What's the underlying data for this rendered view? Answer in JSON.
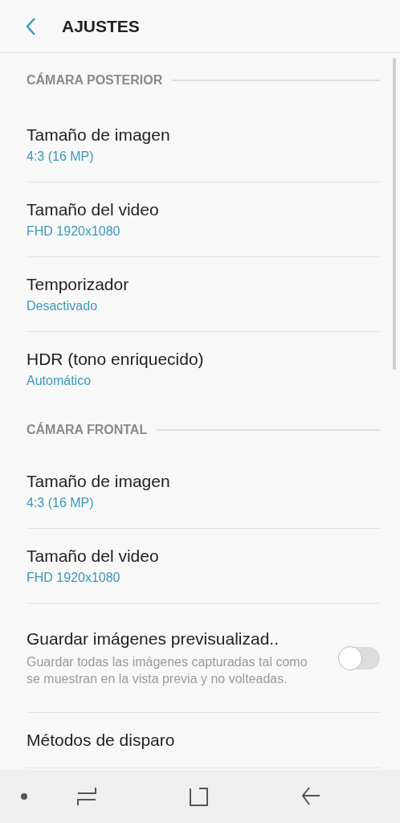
{
  "header": {
    "title": "AJUSTES"
  },
  "sections": [
    {
      "title": "CÁMARA POSTERIOR",
      "items": [
        {
          "kind": "value",
          "title": "Tamaño de imagen",
          "value": "4:3 (16 MP)"
        },
        {
          "kind": "value",
          "title": "Tamaño del video",
          "value": "FHD 1920x1080"
        },
        {
          "kind": "value",
          "title": "Temporizador",
          "value": "Desactivado"
        },
        {
          "kind": "value",
          "title": "HDR (tono enriquecido)",
          "value": "Automático"
        }
      ]
    },
    {
      "title": "CÁMARA FRONTAL",
      "items": [
        {
          "kind": "value",
          "title": "Tamaño de imagen",
          "value": "4:3 (16 MP)"
        },
        {
          "kind": "value",
          "title": "Tamaño del video",
          "value": "FHD 1920x1080"
        },
        {
          "kind": "toggle",
          "title": "Guardar imágenes previsualizad..",
          "description": "Guardar todas las imágenes capturadas tal como se muestran en la vista previa y no volteadas.",
          "on": false
        },
        {
          "kind": "plain",
          "title": "Métodos de disparo"
        }
      ]
    }
  ]
}
